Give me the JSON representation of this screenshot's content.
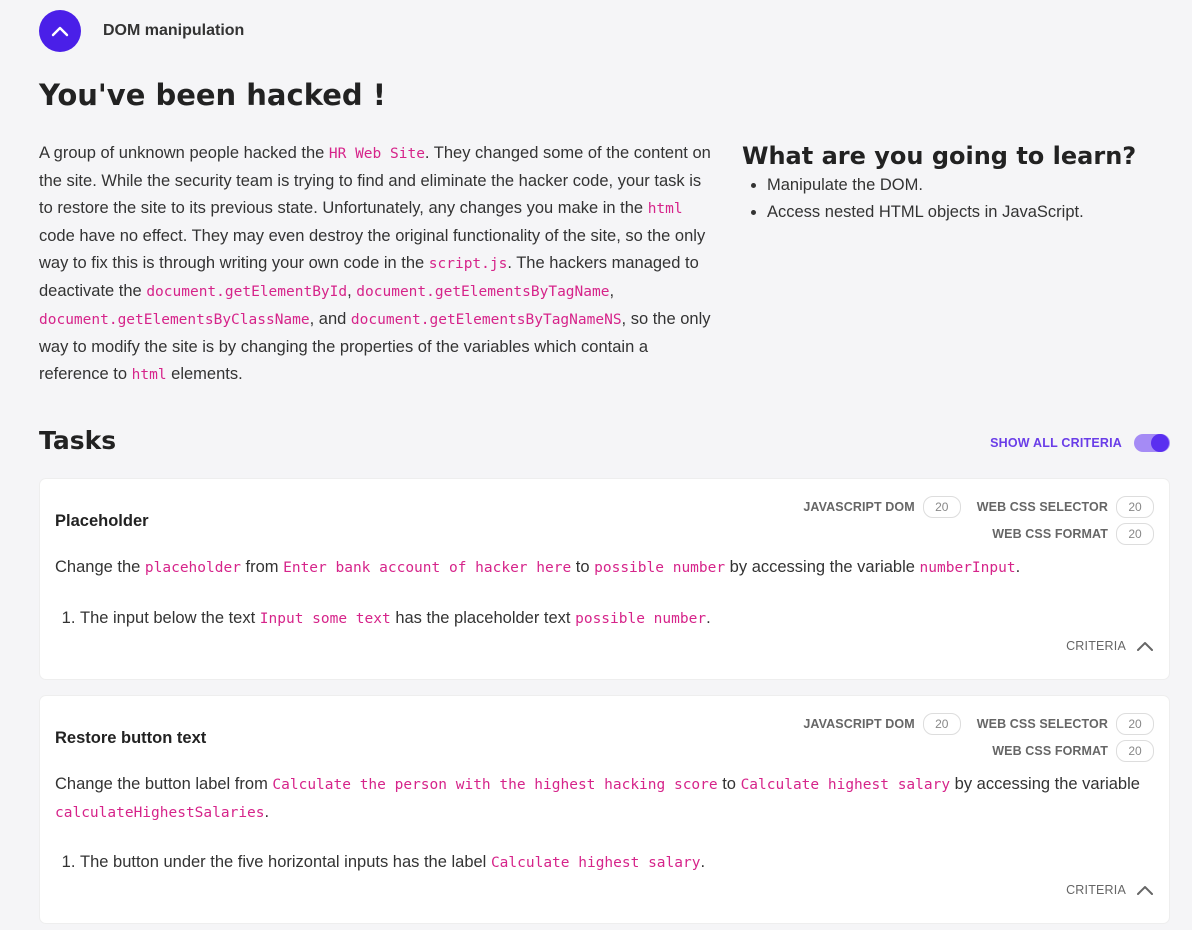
{
  "header": {
    "title": "DOM manipulation"
  },
  "page": {
    "title": "You've been hacked !"
  },
  "intro": {
    "t1": "A group of unknown people hacked the ",
    "c1": "HR Web Site",
    "t2": ". They changed some of the content on the site. While the security team is trying to find and eliminate the hacker code, your task is to restore the site to its previous state. Unfortunately, any changes you make in the ",
    "c2": "html",
    "t3": " code have no effect. They may even destroy the original functionality of the site, so the only way to fix this is through writing your own code in the ",
    "c3": "script.js",
    "t4": ". The hackers managed to deactivate the ",
    "c4": "document.getElementById",
    "t5": ", ",
    "c5": "document.getElementsByTagName",
    "t6": ", ",
    "c6": "document.getElementsByClassName",
    "t7": ", and ",
    "c7": "document.getElementsByTagNameNS",
    "t8": ", so the only way to modify the site is by changing the properties of the variables which contain a reference to ",
    "c8": "html",
    "t9": " elements."
  },
  "learn": {
    "heading": "What are you going to learn?",
    "items": [
      "Manipulate the DOM.",
      "Access nested HTML objects in JavaScript."
    ]
  },
  "tasks": {
    "heading": "Tasks",
    "show_all_label": "SHOW ALL CRITERIA",
    "items": [
      {
        "title": "Placeholder",
        "badges": {
          "js_dom": "JAVASCRIPT DOM",
          "js_dom_score": "20",
          "css_selector": "WEB CSS SELECTOR",
          "css_selector_score": "20",
          "css_format": "WEB CSS FORMAT",
          "css_format_score": "20"
        },
        "desc": {
          "t1": "Change the ",
          "c1": "placeholder",
          "t2": " from ",
          "c2": "Enter bank account of hacker here",
          "t3": " to ",
          "c3": "possible number",
          "t4": " by accessing the variable ",
          "c4": "numberInput",
          "t5": "."
        },
        "criterion": {
          "t1": "The input below the text ",
          "c1": "Input some text",
          "t2": " has the placeholder text ",
          "c2": "possible number",
          "t3": "."
        },
        "criteria_label": "CRITERIA"
      },
      {
        "title": "Restore button text",
        "badges": {
          "js_dom": "JAVASCRIPT DOM",
          "js_dom_score": "20",
          "css_selector": "WEB CSS SELECTOR",
          "css_selector_score": "20",
          "css_format": "WEB CSS FORMAT",
          "css_format_score": "20"
        },
        "desc": {
          "t1": "Change the button label from ",
          "c1": "Calculate the person with the highest hacking score",
          "t2": " to ",
          "c2": "Calculate highest salary",
          "t3": " by accessing the variable ",
          "c3": "calculateHighestSalaries",
          "t4": "."
        },
        "criterion": {
          "t1": "The button under the five horizontal inputs has the label ",
          "c1": "Calculate highest salary",
          "t2": "."
        },
        "criteria_label": "CRITERIA"
      }
    ]
  },
  "colors": {
    "accent": "#4a1fe8",
    "code": "#d6248a",
    "toggle_track": "#a58bf5",
    "toggle_knob": "#5a2ff0"
  },
  "icons": {
    "collapse": "chevron-up-icon",
    "criteria": "chevron-up-icon"
  }
}
